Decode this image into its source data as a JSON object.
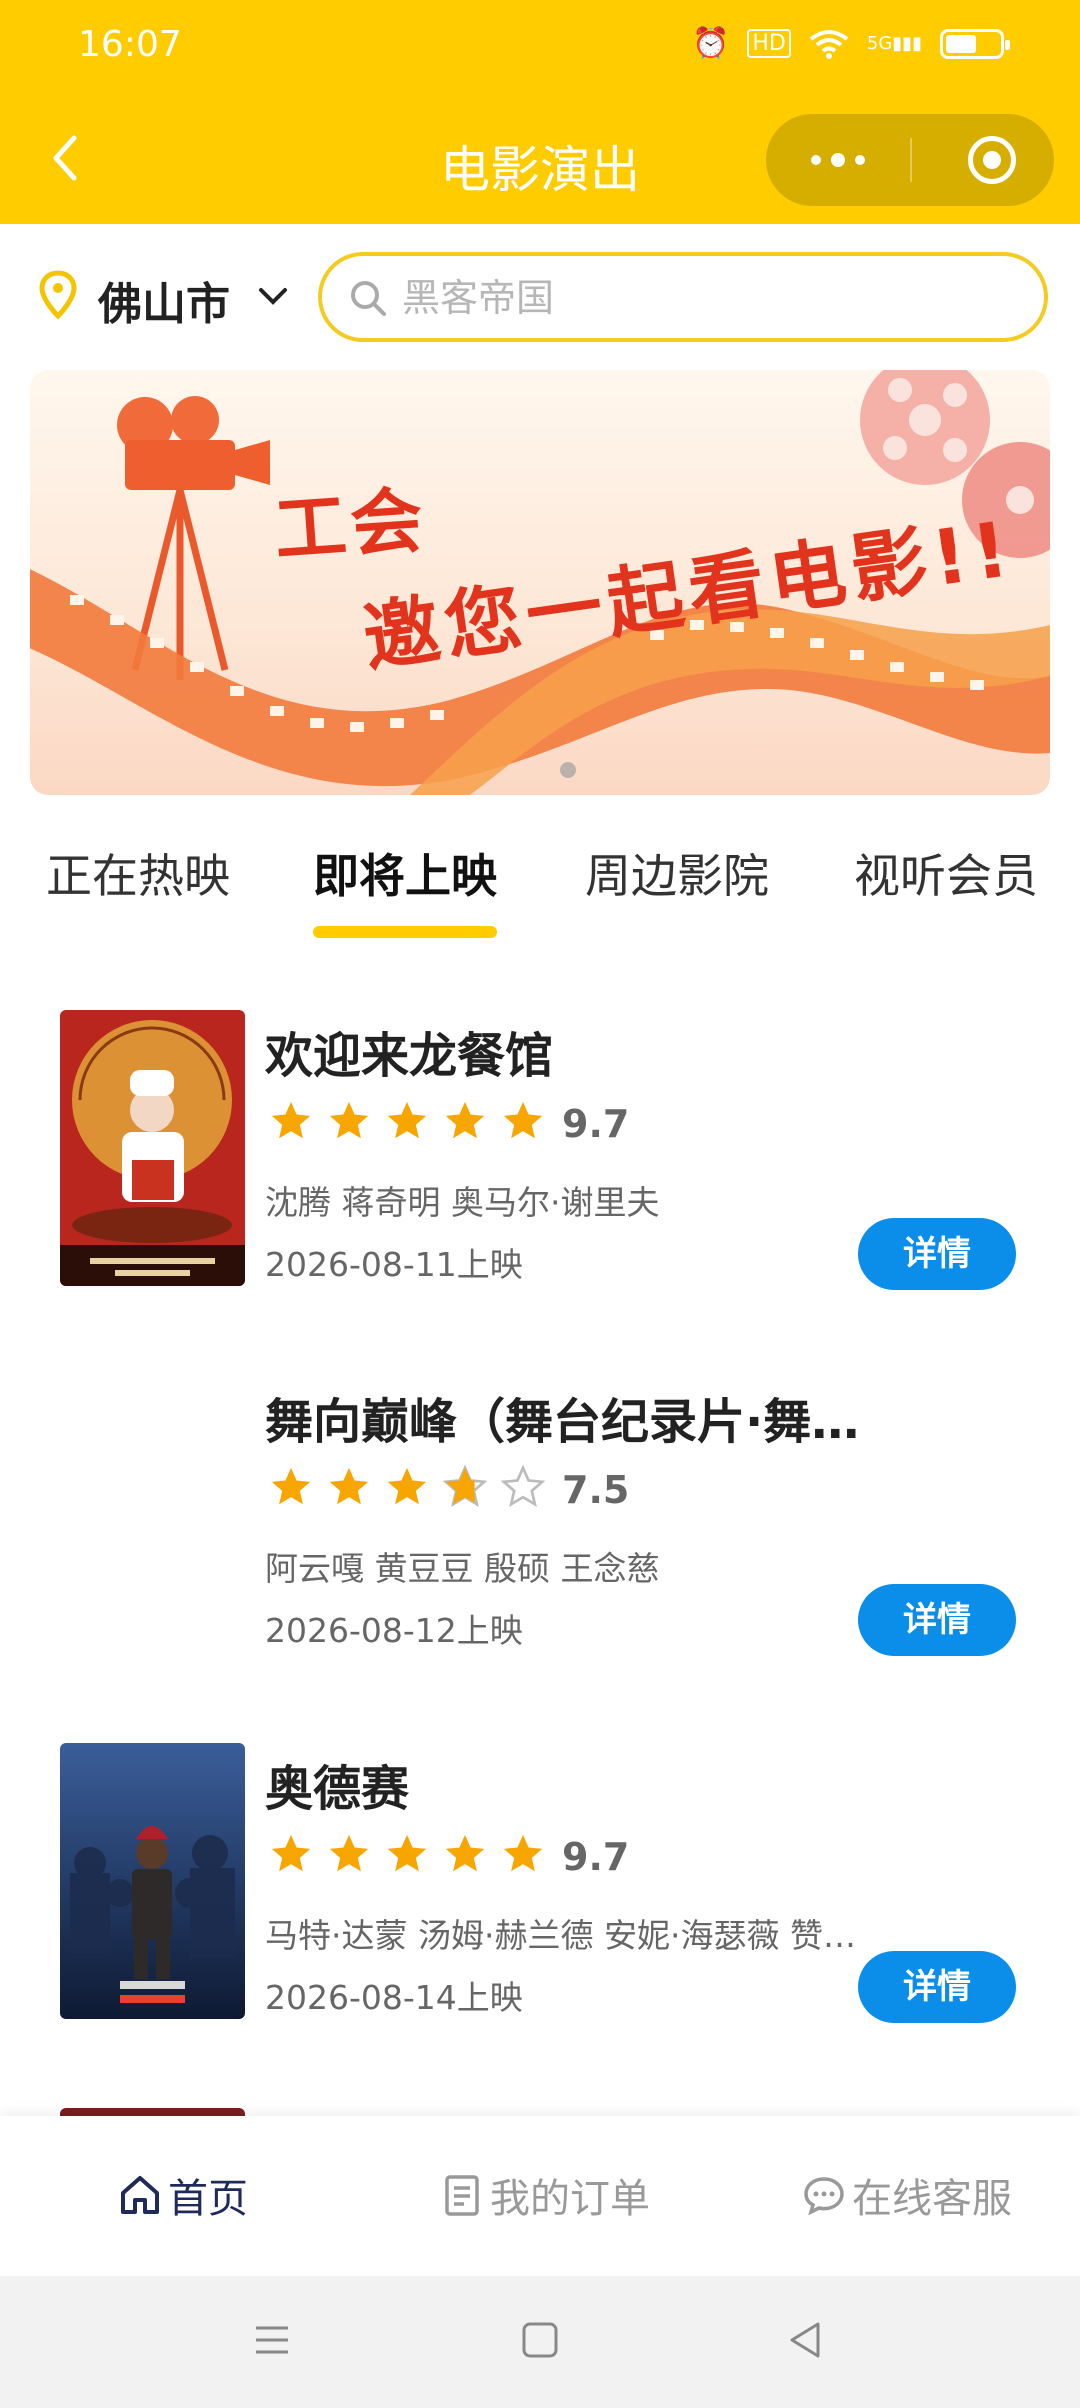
{
  "status": {
    "time": "16:07",
    "network": "5G"
  },
  "header": {
    "title": "电影演出"
  },
  "location": {
    "city": "佛山市"
  },
  "search": {
    "placeholder": "黑客帝国"
  },
  "banner": {
    "line1": "工会",
    "line2": "邀您一起看电影!!"
  },
  "tabs": [
    {
      "label": "正在热映",
      "active": false
    },
    {
      "label": "即将上映",
      "active": true
    },
    {
      "label": "周边影院",
      "active": false
    },
    {
      "label": "视听会员",
      "active": false
    }
  ],
  "movies": [
    {
      "title": "欢迎来龙餐馆",
      "rating": 9.7,
      "score": "9.7",
      "cast": "沈腾 蒋奇明 奥马尔·谢里夫",
      "date": "2026-08-11上映",
      "button": "详情",
      "has_poster": true
    },
    {
      "title": "舞向巅峰（舞台纪录片·舞...",
      "rating": 7.5,
      "score": "7.5",
      "cast": "阿云嘎 黄豆豆 殷硕 王念慈",
      "date": "2026-08-12上映",
      "button": "详情",
      "has_poster": false
    },
    {
      "title": "奥德赛",
      "rating": 9.7,
      "score": "9.7",
      "cast": "马特·达蒙 汤姆·赫兰德 安妮·海瑟薇 赞达...",
      "date": "2026-08-14上映",
      "button": "详情",
      "has_poster": true
    }
  ],
  "bottom_nav": [
    {
      "label": "首页",
      "icon": "home-icon",
      "active": true
    },
    {
      "label": "我的订单",
      "icon": "order-icon",
      "active": false
    },
    {
      "label": "在线客服",
      "icon": "chat-icon",
      "active": false
    }
  ],
  "colors": {
    "brand_yellow": "#FFCC00",
    "detail_blue": "#0A8EEA",
    "star": "#F7A600"
  }
}
